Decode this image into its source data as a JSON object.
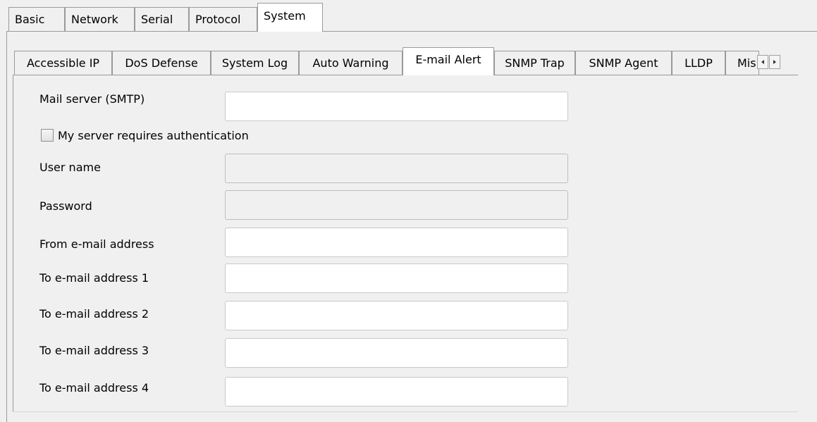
{
  "top_tabs": [
    "Basic",
    "Network",
    "Serial",
    "Protocol",
    "System"
  ],
  "top_active": "System",
  "sub_tabs": [
    "Accessible IP",
    "DoS Defense",
    "System Log",
    "Auto Warning",
    "E-mail Alert",
    "SNMP Trap",
    "SNMP Agent",
    "LLDP",
    "Mis"
  ],
  "sub_active": "E-mail Alert",
  "form": {
    "mail_server_label": "Mail server (SMTP)",
    "mail_server_value": "",
    "auth_label": "My server requires authentication",
    "auth_checked": false,
    "username_label": "User name",
    "username_value": "",
    "password_label": "Password",
    "password_value": "",
    "from_label": "From e-mail address",
    "from_value": "",
    "to1_label": "To e-mail address 1",
    "to1_value": "",
    "to2_label": "To e-mail address 2",
    "to2_value": "",
    "to3_label": "To e-mail address 3",
    "to3_value": "",
    "to4_label": "To e-mail address 4",
    "to4_value": ""
  },
  "icons": {
    "scroll_left": "arrow-left-icon",
    "scroll_right": "arrow-right-icon"
  }
}
